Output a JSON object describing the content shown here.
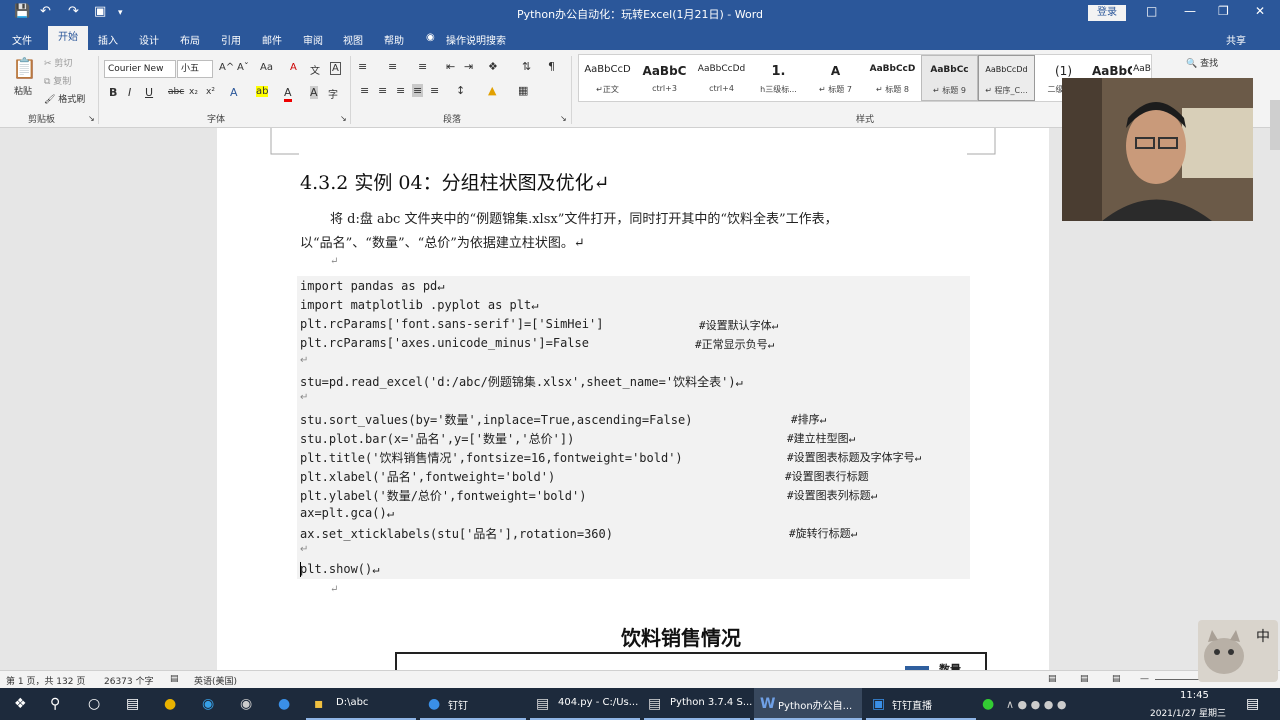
{
  "title_bar": {
    "doc_title": "Python办公自动化：玩转Excel(1月21日)  -  Word",
    "login": "登录",
    "quick_access": [
      "save-icon",
      "undo-icon",
      "redo-icon",
      "print-preview-icon",
      "customize-icon"
    ]
  },
  "tabs": [
    "文件",
    "开始",
    "插入",
    "设计",
    "布局",
    "引用",
    "邮件",
    "审阅",
    "视图",
    "帮助"
  ],
  "tell_me": "操作说明搜索",
  "share": "共享",
  "ribbon": {
    "clipboard": {
      "paste": "粘贴",
      "cut": "剪切",
      "copy": "复制",
      "format_painter": "格式刷",
      "group": "剪贴板"
    },
    "font": {
      "name": "Courier New",
      "size": "小五",
      "group": "字体",
      "bold": "B",
      "italic": "I",
      "underline": "U",
      "strike": "abc",
      "sub": "x₂",
      "sup": "x²",
      "grow": "A^",
      "shrink": "Aˇ",
      "case": "Aa",
      "clear": "A",
      "phonetic": "文",
      "border": "A",
      "effects": "A",
      "highlight": "ab",
      "color": "A",
      "shade": "A",
      "circle": "字"
    },
    "paragraph": {
      "group": "段落"
    },
    "styles": {
      "group": "样式",
      "items": [
        {
          "preview": "AaBbCcD",
          "name": "↵正文"
        },
        {
          "preview": "AaBbC",
          "name": "ctrl+3"
        },
        {
          "preview": "AaBbCcDd",
          "name": "ctrl+4"
        },
        {
          "preview": "1.",
          "name": "h三级标..."
        },
        {
          "preview": "A",
          "name": "↵ 标题 7"
        },
        {
          "preview": "AaBbCcD",
          "name": "↵ 标题 8"
        },
        {
          "preview": "AaBbCc",
          "name": "↵ 标题 9"
        },
        {
          "preview": "AaBbCcDd",
          "name": "↵ 程序_C..."
        },
        {
          "preview": "(1)",
          "name": "二级标题"
        },
        {
          "preview": "AaBbC",
          "name": ""
        },
        {
          "preview": "AaB",
          "name": ""
        }
      ]
    },
    "editing": {
      "find": "查找"
    }
  },
  "document": {
    "heading": "4.3.2 实例 04：分组柱状图及优化↵",
    "para1": "将 d:盘 abc 文件夹中的“例题锦集.xlsx”文件打开，同时打开其中的“饮料全表”工作表，",
    "para2": "以“品名”、“数量”、“总价”为依据建立柱状图。↵",
    "code": [
      {
        "text": "import pandas as pd↵",
        "comment": ""
      },
      {
        "text": "import matplotlib .pyplot as plt↵",
        "comment": ""
      },
      {
        "text": "plt.rcParams['font.sans-serif']=['SimHei']",
        "comment": "#设置默认字体↵"
      },
      {
        "text": "plt.rcParams['axes.unicode_minus']=False",
        "comment": "#正常显示负号↵"
      },
      {
        "text": "↵",
        "comment": ""
      },
      {
        "text": "stu=pd.read_excel('d:/abc/例题锦集.xlsx',sheet_name='饮料全表')↵",
        "comment": ""
      },
      {
        "text": "↵",
        "comment": ""
      },
      {
        "text": "stu.sort_values(by='数量',inplace=True,ascending=False)",
        "comment": "#排序↵"
      },
      {
        "text": "stu.plot.bar(x='品名',y=['数量','总价'])",
        "comment": "#建立柱型图↵"
      },
      {
        "text": "plt.title('饮料销售情况',fontsize=16,fontweight='bold')",
        "comment": "#设置图表标题及字体字号↵"
      },
      {
        "text": "plt.xlabel('品名',fontweight='bold')",
        "comment": "#设置图表行标题"
      },
      {
        "text": "plt.ylabel('数量/总价',fontweight='bold')",
        "comment": "#设置图表列标题↵"
      },
      {
        "text": "ax=plt.gca()↵",
        "comment": ""
      },
      {
        "text": "ax.set_xticklabels(stu['品名'],rotation=360)",
        "comment": "#旋转行标题↵"
      },
      {
        "text": "↵",
        "comment": ""
      },
      {
        "text": "plt.show()↵",
        "comment": ""
      }
    ],
    "chart_title": "饮料销售情况",
    "legend_first": "数量"
  },
  "status": {
    "page": "第 1 页，共 132 页",
    "words": "26373 个字",
    "lang": "英语(美国)"
  },
  "taskbar": {
    "items": [
      {
        "icon": "folder-icon",
        "label": "D:\\abc"
      },
      {
        "icon": "dingtalk-icon",
        "label": "钉钉"
      },
      {
        "icon": "python-file-icon",
        "label": "404.py - C:/Us..."
      },
      {
        "icon": "python-shell-icon",
        "label": "Python 3.7.4 S..."
      },
      {
        "icon": "word-icon",
        "label": "Python办公自..."
      },
      {
        "icon": "live-icon",
        "label": "钉钉直播"
      }
    ],
    "time": "11:45",
    "date": "2021/1/27 星期三",
    "ime": "中"
  },
  "colors": {
    "accent": "#2b579a",
    "taskbar": "#1d2a3c"
  }
}
